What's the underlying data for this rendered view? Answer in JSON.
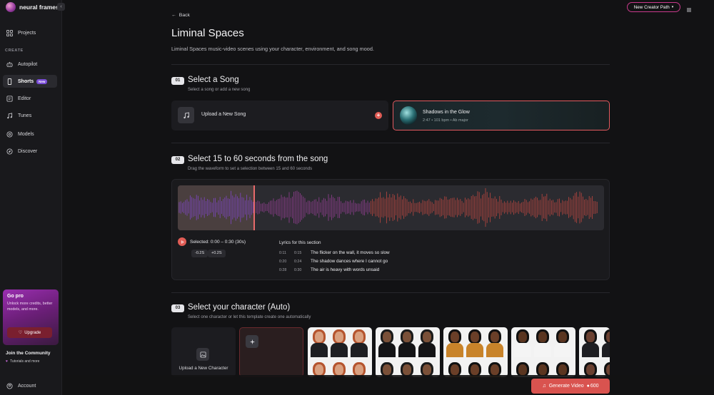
{
  "brand": {
    "name": "neural frames"
  },
  "sidebar": {
    "collapse_icon": "‹",
    "section_create": "CREATE",
    "items": [
      {
        "key": "projects",
        "label": "Projects",
        "icon": "grid-icon"
      },
      {
        "key": "autopilot",
        "label": "Autopilot",
        "icon": "robot-icon"
      },
      {
        "key": "shorts",
        "label": "Shorts",
        "icon": "phone-icon",
        "badge": "New",
        "active": true
      },
      {
        "key": "editor",
        "label": "Editor",
        "icon": "editor-icon"
      },
      {
        "key": "tunes",
        "label": "Tunes",
        "icon": "music-icon"
      },
      {
        "key": "models",
        "label": "Models",
        "icon": "models-icon"
      },
      {
        "key": "discover",
        "label": "Discover",
        "icon": "compass-icon"
      }
    ],
    "gopro": {
      "title": "Go pro",
      "text": "Unlock more credits, better models, and more.",
      "button": "Upgrade"
    },
    "community": {
      "title": "Join the Community",
      "subtitle": "Tutorials and more"
    },
    "account": "Account"
  },
  "topbar": {
    "creator_path": "New Creator Path"
  },
  "page": {
    "back": "Back",
    "title": "Liminal Spaces",
    "description": "Liminal Spaces music-video scenes using your character, environment, and song mood."
  },
  "step1": {
    "num": "01",
    "title": "Select a Song",
    "subtitle": "Select a song or add a new song",
    "upload_label": "Upload a New Song",
    "song": {
      "name": "Shadows in the Glow",
      "meta": "2:47 • 101 bpm • Ab major"
    }
  },
  "step2": {
    "num": "02",
    "title": "Select 15 to 60 seconds from the song",
    "subtitle": "Drag the waveform to set a selection between 15 and 60 seconds",
    "selected": "Selected: 0:00 – 0:30 (30s)",
    "nudge_minus": "-0.2S",
    "nudge_plus": "+0.2S",
    "lyrics_title": "Lyrics for this section",
    "lyrics": [
      {
        "start": "0:11",
        "end": "0:15",
        "text": "The flicker on the wall, it moves so slow"
      },
      {
        "start": "0:20",
        "end": "0:24",
        "text": "The shadow dances where I cannot go"
      },
      {
        "start": "0:28",
        "end": "0:30",
        "text": "The air is heavy with words unsaid"
      }
    ]
  },
  "step3": {
    "num": "03",
    "title": "Select your character (Auto)",
    "subtitle": "Select one character or let this template create one automatically",
    "upload_label": "Upload a New Character"
  },
  "generate": {
    "label": "Generate Video",
    "credits": "600"
  },
  "colors": {
    "accent": "#e05c55",
    "brand": "#7b4ed8",
    "border_pink": "#c83a8c"
  }
}
